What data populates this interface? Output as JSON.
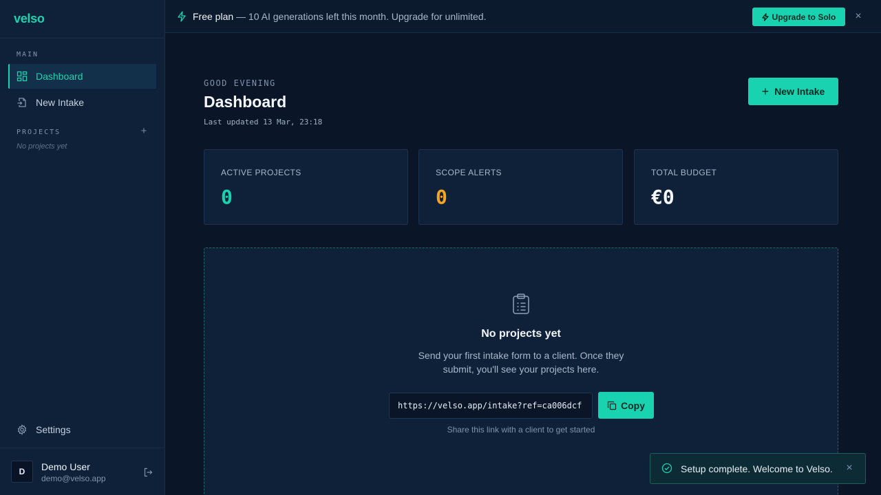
{
  "app": {
    "logo": "velso"
  },
  "sidebar": {
    "main_label": "MAIN",
    "items": [
      {
        "label": "Dashboard",
        "icon": "dashboard-icon",
        "active": true
      },
      {
        "label": "New Intake",
        "icon": "file-import-icon",
        "active": false
      }
    ],
    "projects_label": "PROJECTS",
    "projects_add": "+",
    "projects_empty": "No projects yet",
    "settings_label": "Settings",
    "user": {
      "initial": "D",
      "name": "Demo User",
      "email": "demo@velso.app"
    }
  },
  "banner": {
    "plan": "Free plan",
    "message": " — 10 AI generations left this month. Upgrade for unlimited.",
    "upgrade_label": "Upgrade to Solo",
    "close": "×"
  },
  "header": {
    "greeting": "GOOD EVENING",
    "title": "Dashboard",
    "last_updated": "Last updated 13 Mar, 23:18",
    "new_intake_label": "New Intake",
    "new_intake_plus": "+"
  },
  "stats": [
    {
      "label": "ACTIVE PROJECTS",
      "value": "0",
      "color": "#19d3b0"
    },
    {
      "label": "SCOPE ALERTS",
      "value": "0",
      "color": "#f5a524"
    },
    {
      "label": "TOTAL BUDGET",
      "value": "€0",
      "color": "#f5f8fb"
    }
  ],
  "empty_state": {
    "title": "No projects yet",
    "description": "Send your first intake form to a client. Once they submit, you'll see your projects here.",
    "link": "https://velso.app/intake?ref=ca006dcf",
    "copy_label": "Copy",
    "hint": "Share this link with a client to get started"
  },
  "toast": {
    "message": "Setup complete. Welcome to Velso.",
    "close": "×"
  },
  "colors": {
    "accent": "#19d3b0",
    "warning": "#f5a524",
    "background": "#0a1628",
    "panel": "#0f2139"
  }
}
